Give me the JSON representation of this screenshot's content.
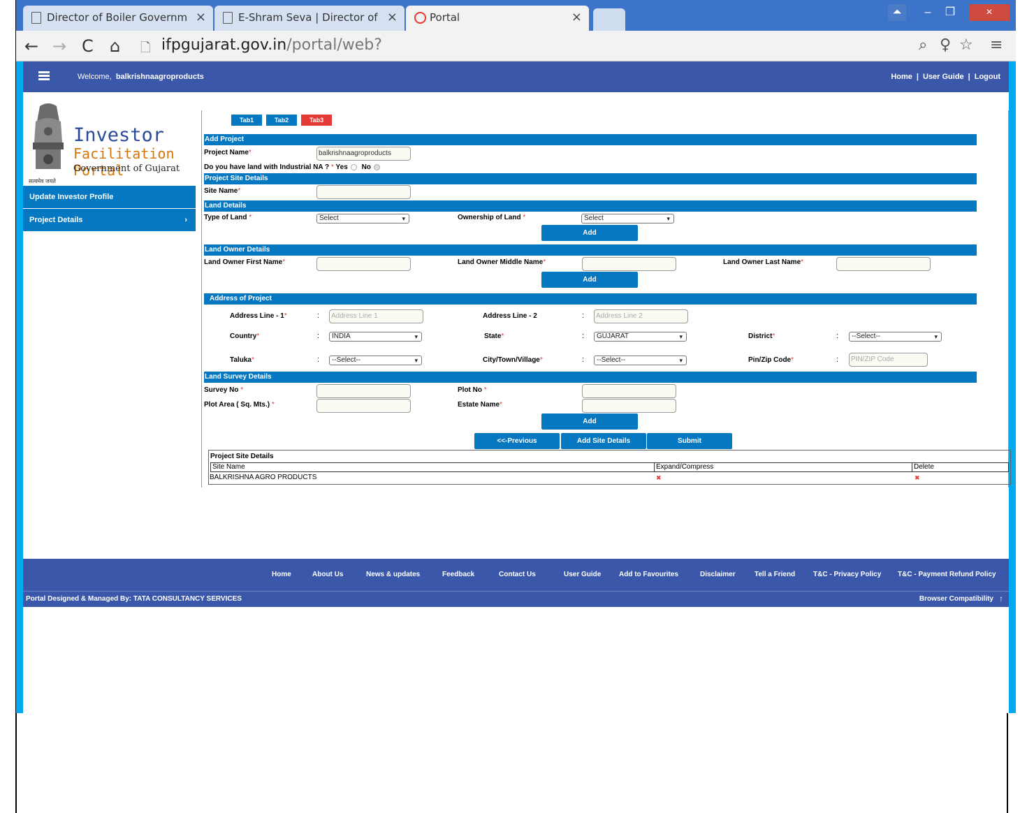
{
  "browser": {
    "tabs": [
      {
        "title": "Director of Boiler Governm",
        "active": false
      },
      {
        "title": "E-Shram Seva | Director of",
        "active": false
      },
      {
        "title": "Portal",
        "active": true
      }
    ],
    "url_host": "ifpgujarat.gov.in",
    "url_path": "/portal/web?"
  },
  "header": {
    "welcome_label": "Welcome,",
    "username": "balkrishnaagroproducts",
    "links": [
      "Home",
      "User Guide",
      "Logout"
    ]
  },
  "logo": {
    "line1": "Investor",
    "line2": "Facilitation Portal",
    "line3": "Government of Gujarat",
    "motto": "सत्यमेव जयते"
  },
  "sidebar": {
    "items": [
      {
        "label": "Update Investor Profile"
      },
      {
        "label": "Project Details",
        "chevron": "›"
      }
    ]
  },
  "form": {
    "tabs": [
      "Tab1",
      "Tab2",
      "Tab3"
    ],
    "sections": {
      "add_project": "Add Project",
      "project_site_details": "Project Site Details",
      "land_details": "Land Details",
      "land_owner_details": "Land Owner Details",
      "address_of_project": "Address of Project",
      "land_survey_details": "Land Survey Details"
    },
    "project_name_label": "Project Name",
    "project_name_value": "balkrishnaagroproducts",
    "industrial_na_label": "Do you have land with Industrial NA ?",
    "yes_label": "Yes",
    "no_label": "No",
    "site_name_label": "Site Name",
    "type_of_land_label": "Type of Land",
    "type_of_land_value": "Select",
    "ownership_label": "Ownership of Land",
    "ownership_value": "Select",
    "add_label": "Add",
    "owner_first_label": "Land Owner First Name",
    "owner_middle_label": "Land Owner Middle Name",
    "owner_last_label": "Land Owner Last Name",
    "address1_label": "Address Line - 1",
    "address1_placeholder": "Address Line 1",
    "address2_label": "Address Line - 2",
    "address2_placeholder": "Address Line 2",
    "country_label": "Country",
    "country_value": "INDIA",
    "state_label": "State",
    "state_value": "GUJARAT",
    "district_label": "District",
    "district_value": "--Select--",
    "taluka_label": "Taluka",
    "taluka_value": "--Select--",
    "city_label": "City/Town/Village",
    "city_value": "--Select--",
    "pin_label": "Pin/Zip Code",
    "pin_placeholder": "PIN/ZIP Code",
    "survey_label": "Survey No",
    "plot_no_label": "Plot No",
    "plot_area_label": "Plot Area ( Sq. Mts.)",
    "estate_label": "Estate Name",
    "previous_label": "<<-Previous",
    "add_site_label": "Add Site Details",
    "submit_label": "Submit",
    "colon": ":"
  },
  "site_table": {
    "title": "Project Site Details",
    "headers": [
      "Site Name",
      "Expand/Compress",
      "Delete"
    ],
    "rows": [
      {
        "site_name": "BALKRISHNA AGRO PRODUCTS"
      }
    ]
  },
  "footer": {
    "links": [
      "Home",
      "About Us",
      "News & updates",
      "Feedback",
      "Contact Us",
      "User Guide",
      "Add to Favourites",
      "Disclaimer",
      "Tell a Friend",
      "T&C - Privacy Policy",
      "T&C - Payment Refund Policy"
    ],
    "designed_by": "Portal Designed & Managed By: TATA CONSULTANCY SERVICES",
    "browser_compat": "Browser Compatibility"
  },
  "colors": {
    "nav_blue": "#3a57a9",
    "section_blue": "#0578c1",
    "tab3_red": "#e53935",
    "background": "#03a9ef"
  }
}
